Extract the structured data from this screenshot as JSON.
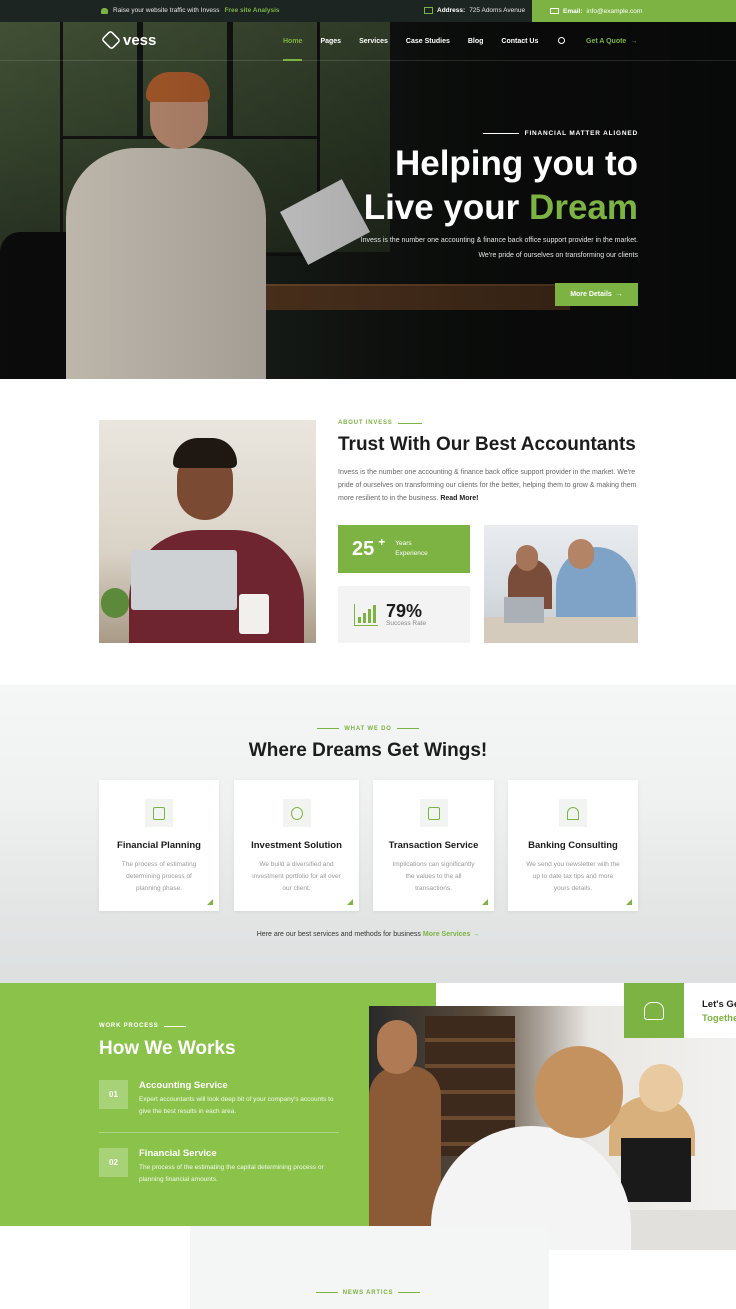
{
  "topbar": {
    "promo_text": "Raise your website traffic with Invess",
    "promo_link": "Free site Analysis",
    "address_label": "Address:",
    "address_value": "725 Adoms Avenue",
    "email_label": "Email:",
    "email_value": "info@example.com"
  },
  "nav": {
    "logo": "vess",
    "items": [
      "Home",
      "Pages",
      "Services",
      "Case Studies",
      "Blog",
      "Contact Us"
    ],
    "active": "Home",
    "quote_label": "Get A Quote",
    "quote_arrow": "→"
  },
  "hero": {
    "tag": "FINANCIAL MATTER ALIGNED",
    "title_line1": "Helping you to",
    "title_line2_a": "Live your",
    "title_line2_b": "Dream",
    "description": "Invess is the number one accounting & finance back office support provider in the market. We're pride of ourselves on transforming our clients",
    "button": "More Details",
    "button_arrow": "→"
  },
  "about": {
    "tag": "ABOUT INVESS",
    "title": "Trust With Our Best Accountants",
    "description": "Invess is the number one accounting & finance back office support provider in the market. We're pride of ourselves on transforming our clients for the better, helping them to grow & making them more resilient to in the business.",
    "read_more": "Read More!",
    "years_number": "25",
    "years_plus": "+",
    "years_label_1": "Years",
    "years_label_2": "Experience",
    "success_value": "79%",
    "success_label": "Success Rate"
  },
  "services": {
    "tag": "WHAT WE DO",
    "title": "Where Dreams Get Wings!",
    "cards": [
      {
        "title": "Financial Planning",
        "desc": "The process of estimating determining process of planning phase."
      },
      {
        "title": "Investment Solution",
        "desc": "We build a diversified and investment portfolio for all over our client."
      },
      {
        "title": "Transaction Service",
        "desc": "Implications can significantly the values to the all transactions."
      },
      {
        "title": "Banking Consulting",
        "desc": "We send you newsletter with the up to date tax tips and more yours details."
      }
    ],
    "footer_text": "Here are our best services and methods for business",
    "footer_link": "More Services",
    "footer_arrow": "→"
  },
  "process": {
    "tag": "WORK PROCESS",
    "title": "How We Works",
    "steps": [
      {
        "num": "01",
        "title": "Accounting Service",
        "desc": "Expert accountants will look deep bit of your company's accounts to give the best results in each area."
      },
      {
        "num": "02",
        "title": "Financial Service",
        "desc": "The process of the estimating the capital determining process or planning financial amounts."
      }
    ],
    "get_line1": "Let's Ge",
    "get_line2": "Togethe"
  },
  "news": {
    "tag": "NEWS ARTICS"
  },
  "colors": {
    "accent": "#7cb342",
    "dark": "#1d2522"
  }
}
